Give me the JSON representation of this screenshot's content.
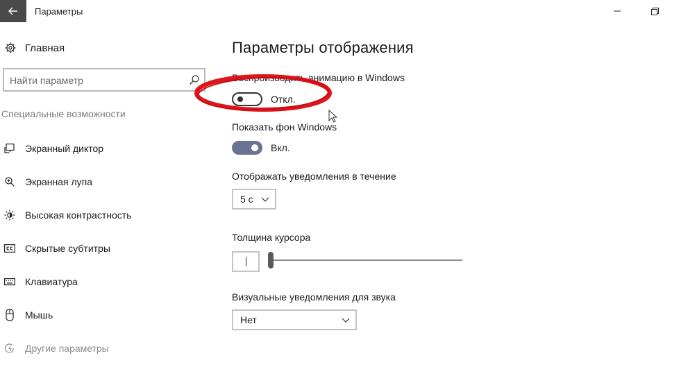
{
  "window": {
    "title": "Параметры"
  },
  "sidebar": {
    "home_label": "Главная",
    "search": {
      "placeholder": "Найти параметр",
      "value": ""
    },
    "section_title": "Специальные возможности",
    "items": [
      {
        "label": "Экранный диктор",
        "icon": "narrator-icon"
      },
      {
        "label": "Экранная лупа",
        "icon": "magnifier-icon"
      },
      {
        "label": "Высокая контрастность",
        "icon": "contrast-icon"
      },
      {
        "label": "Скрытые субтитры",
        "icon": "closed-captions-icon"
      },
      {
        "label": "Клавиатура",
        "icon": "keyboard-icon"
      },
      {
        "label": "Мышь",
        "icon": "mouse-icon"
      },
      {
        "label": "Другие параметры",
        "icon": "other-options-icon"
      }
    ]
  },
  "main": {
    "title": "Параметры отображения",
    "animation": {
      "label": "Воспроизводить анимацию в Windows",
      "state": "Откл.",
      "on": false
    },
    "background": {
      "label": "Показать фон Windows",
      "state": "Вкл.",
      "on": true
    },
    "notifications": {
      "label": "Отображать уведомления в течение",
      "value": "5 с"
    },
    "cursor": {
      "label": "Толщина курсора",
      "thickness": 1
    },
    "visual_alerts": {
      "label": "Визуальные уведомления для звука",
      "value": "Нет"
    }
  },
  "colors": {
    "toggle_on": "#6b7393",
    "annotation": "#e0141c",
    "back_button": "#4a4a4a"
  }
}
